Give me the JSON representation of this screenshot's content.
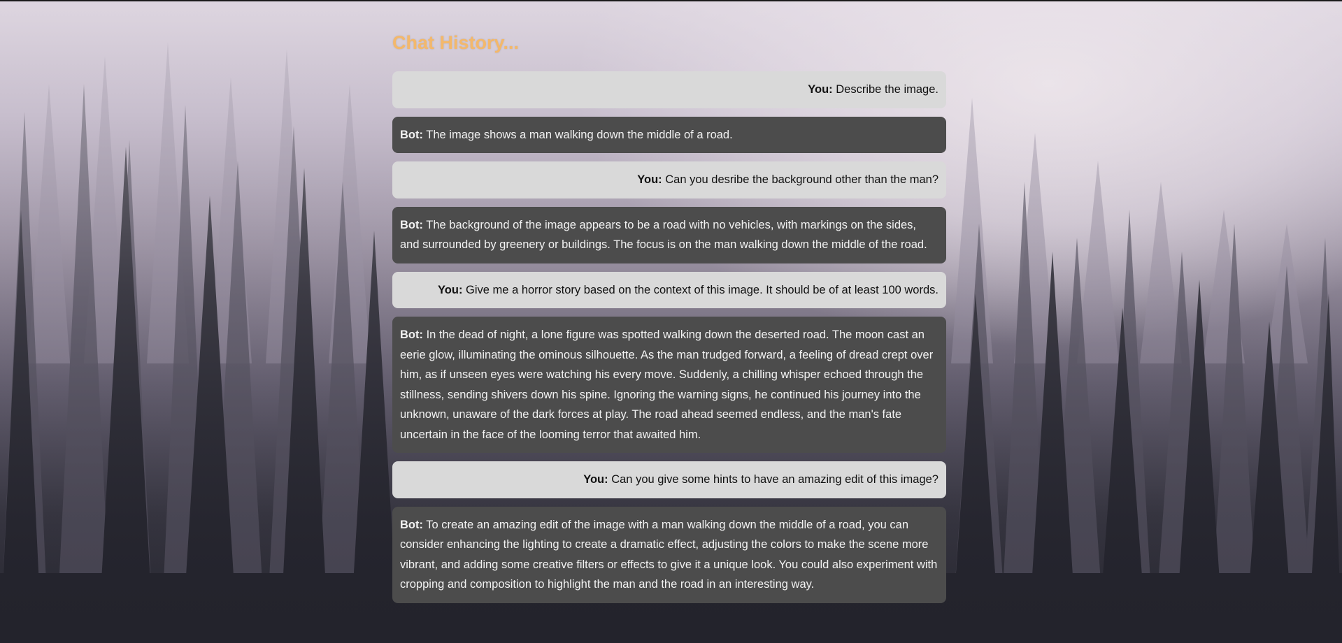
{
  "page": {
    "title": "Chat History..."
  },
  "colors": {
    "title": "#f3b86b",
    "user_bubble": "#d9d9d9",
    "bot_bubble": "#4c4c4c",
    "user_text": "#111111",
    "bot_text": "#f2f2f2"
  },
  "messages": [
    {
      "role": "user",
      "speaker": "You:",
      "text": "Describe the image."
    },
    {
      "role": "bot",
      "speaker": "Bot:",
      "text": "The image shows a man walking down the middle of a road."
    },
    {
      "role": "user",
      "speaker": "You:",
      "text": "Can you desribe the background other than the man?"
    },
    {
      "role": "bot",
      "speaker": "Bot:",
      "text": "The background of the image appears to be a road with no vehicles, with markings on the sides, and surrounded by greenery or buildings. The focus is on the man walking down the middle of the road."
    },
    {
      "role": "user",
      "speaker": "You:",
      "text": "Give me a horror story based on the context of this image. It should be of at least 100 words."
    },
    {
      "role": "bot",
      "speaker": "Bot:",
      "text": "In the dead of night, a lone figure was spotted walking down the deserted road. The moon cast an eerie glow, illuminating the ominous silhouette. As the man trudged forward, a feeling of dread crept over him, as if unseen eyes were watching his every move. Suddenly, a chilling whisper echoed through the stillness, sending shivers down his spine. Ignoring the warning signs, he continued his journey into the unknown, unaware of the dark forces at play. The road ahead seemed endless, and the man's fate uncertain in the face of the looming terror that awaited him."
    },
    {
      "role": "user",
      "speaker": "You:",
      "text": "Can you give some hints to have an amazing edit of this image?"
    },
    {
      "role": "bot",
      "speaker": "Bot:",
      "text": "To create an amazing edit of the image with a man walking down the middle of a road, you can consider enhancing the lighting to create a dramatic effect, adjusting the colors to make the scene more vibrant, and adding some creative filters or effects to give it a unique look. You could also experiment with cropping and composition to highlight the man and the road in an interesting way."
    }
  ]
}
